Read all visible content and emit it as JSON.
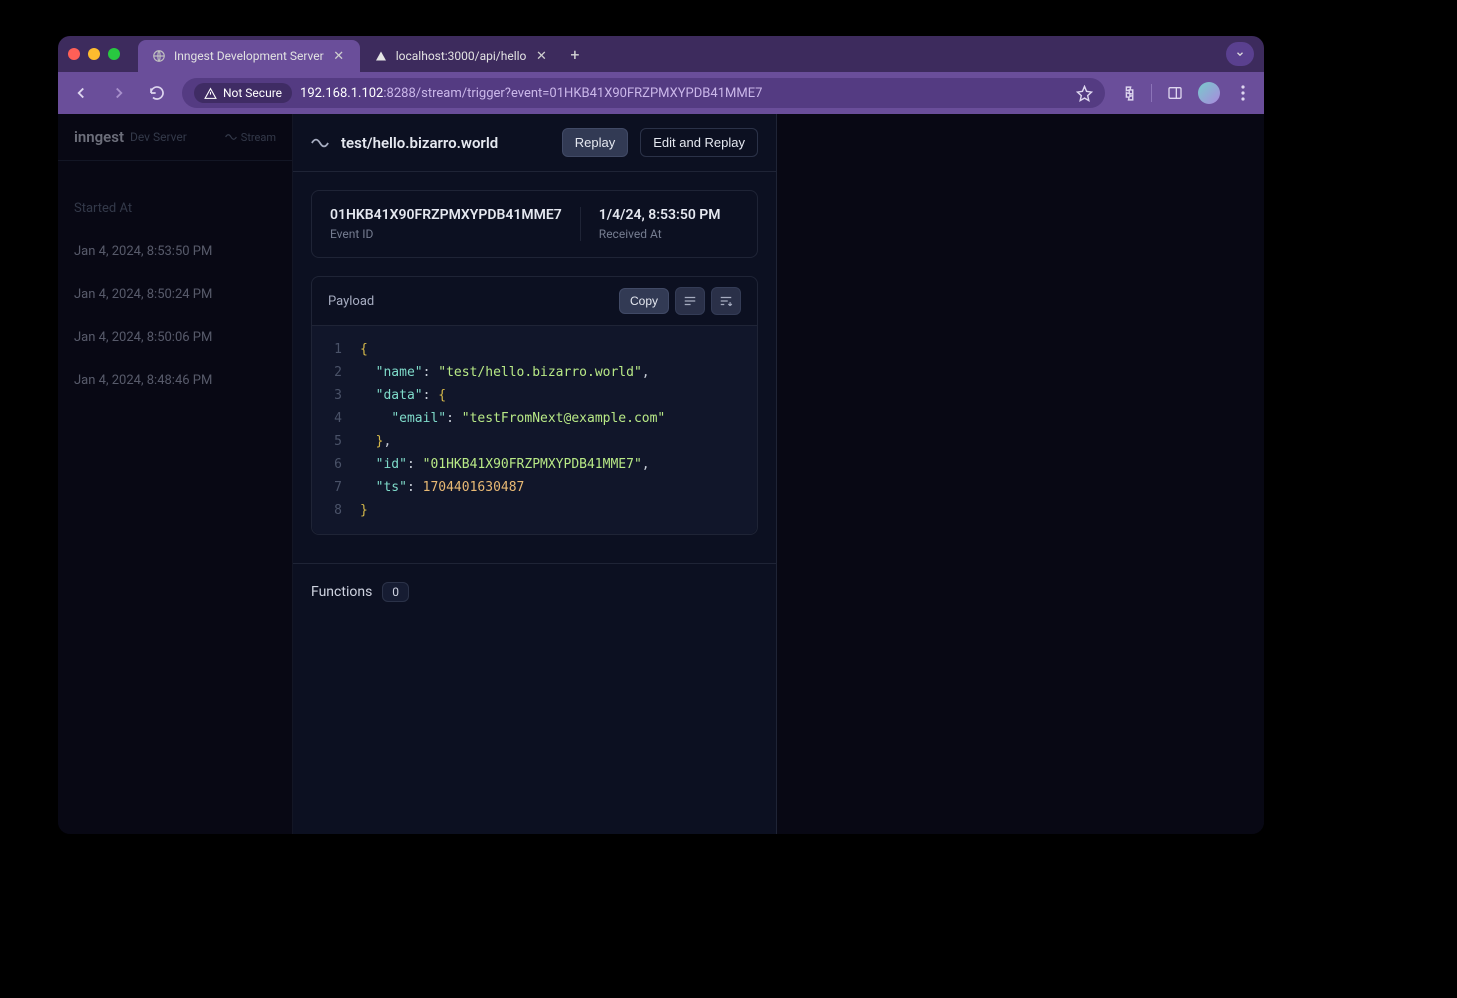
{
  "browser": {
    "tabs": [
      {
        "title": "Inngest Development Server",
        "active": true
      },
      {
        "title": "localhost:3000/api/hello",
        "active": false
      }
    ],
    "notSecure": "Not Secure",
    "urlHost": "192.168.1.102",
    "urlRest": ":8288/stream/trigger?event=01HKB41X90FRZPMXYPDB41MME7"
  },
  "sidebar": {
    "brand": "inngest",
    "brandSub": "Dev Server",
    "streamLabel": "Stream",
    "columnHeader": "Started At",
    "rows": [
      "Jan 4, 2024, 8:53:50 PM",
      "Jan 4, 2024, 8:50:24 PM",
      "Jan 4, 2024, 8:50:06 PM",
      "Jan 4, 2024, 8:48:46 PM"
    ]
  },
  "detail": {
    "eventName": "test/hello.bizarro.world",
    "replay": "Replay",
    "editReplay": "Edit and Replay",
    "info": {
      "eventIdValue": "01HKB41X90FRZPMXYPDB41MME7",
      "eventIdLabel": "Event ID",
      "receivedValue": "1/4/24, 8:53:50 PM",
      "receivedLabel": "Received At"
    },
    "payload": {
      "label": "Payload",
      "copy": "Copy",
      "json": {
        "name": "test/hello.bizarro.world",
        "data": {
          "email": "testFromNext@example.com"
        },
        "id": "01HKB41X90FRZPMXYPDB41MME7",
        "ts": 1704401630487
      }
    },
    "functions": {
      "label": "Functions",
      "count": "0"
    }
  }
}
